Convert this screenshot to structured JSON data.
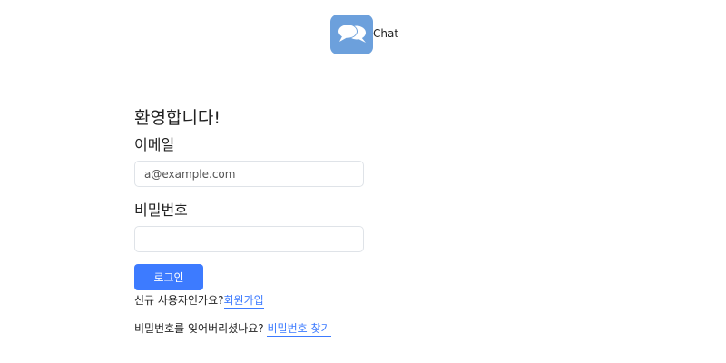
{
  "header": {
    "logo_icon": "chat-bubbles-icon",
    "brand_text": "Chat",
    "icon_color": "#6ca0dc"
  },
  "form": {
    "welcome": "환영합니다!",
    "email_label": "이메일",
    "email_placeholder": "a@example.com",
    "email_value": "",
    "password_label": "비밀번호",
    "password_value": "",
    "login_label": "로그인",
    "accent_color": "#3d7bff"
  },
  "footer": {
    "signup_prompt": "신규 사용자인가요?",
    "signup_link": "회원가입",
    "forgot_prompt": "비밀번호를 잊어버리셨나요? ",
    "forgot_link": "비밀번호 찾기"
  }
}
